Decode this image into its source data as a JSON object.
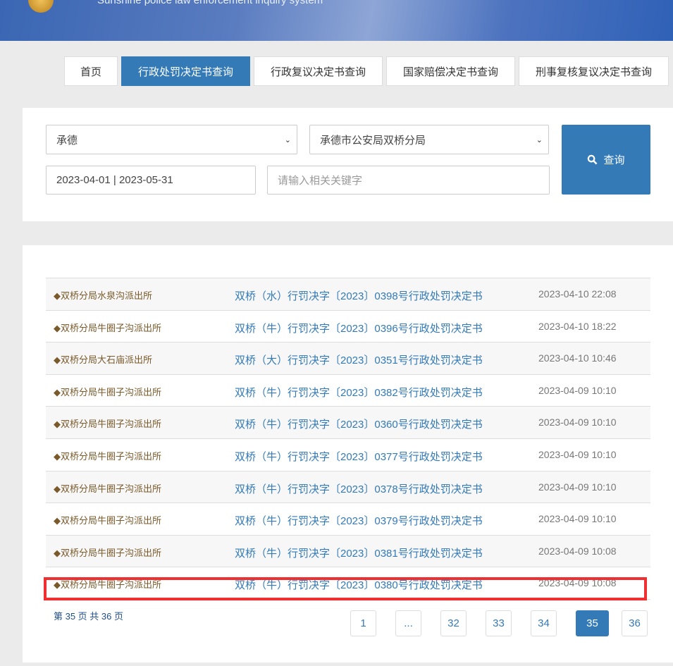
{
  "header": {
    "subtitle": "Sunshine police law enforcement inquiry system"
  },
  "nav": [
    "首页",
    "行政处罚决定书查询",
    "行政复议决定书查询",
    "国家赔偿决定书查询",
    "刑事复核复议决定书查询"
  ],
  "search": {
    "city": "承德",
    "bureau": "承德市公安局双桥分局",
    "date_range": "2023-04-01 | 2023-05-31",
    "keyword_placeholder": "请输入相关关键字",
    "query_label": "查询"
  },
  "results": [
    {
      "branch": "◆双桥分局水泉沟派出所",
      "title": "双桥（水）行罚决字〔2023〕0398号行政处罚决定书",
      "date": "2023-04-10 22:08"
    },
    {
      "branch": "◆双桥分局牛圈子沟派出所",
      "title": "双桥（牛）行罚决字〔2023〕0396号行政处罚决定书",
      "date": "2023-04-10 18:22"
    },
    {
      "branch": "◆双桥分局大石庙派出所",
      "title": "双桥（大）行罚决字〔2023〕0351号行政处罚决定书",
      "date": "2023-04-10 10:46"
    },
    {
      "branch": "◆双桥分局牛圈子沟派出所",
      "title": "双桥（牛）行罚决字〔2023〕0382号行政处罚决定书",
      "date": "2023-04-09 10:10"
    },
    {
      "branch": "◆双桥分局牛圈子沟派出所",
      "title": "双桥（牛）行罚决字〔2023〕0360号行政处罚决定书",
      "date": "2023-04-09 10:10"
    },
    {
      "branch": "◆双桥分局牛圈子沟派出所",
      "title": "双桥（牛）行罚决字〔2023〕0377号行政处罚决定书",
      "date": "2023-04-09 10:10"
    },
    {
      "branch": "◆双桥分局牛圈子沟派出所",
      "title": "双桥（牛）行罚决字〔2023〕0378号行政处罚决定书",
      "date": "2023-04-09 10:10"
    },
    {
      "branch": "◆双桥分局牛圈子沟派出所",
      "title": "双桥（牛）行罚决字〔2023〕0379号行政处罚决定书",
      "date": "2023-04-09 10:10"
    },
    {
      "branch": "◆双桥分局牛圈子沟派出所",
      "title": "双桥（牛）行罚决字〔2023〕0381号行政处罚决定书",
      "date": "2023-04-09 10:08"
    },
    {
      "branch": "◆双桥分局牛圈子沟派出所",
      "title": "双桥（牛）行罚决字〔2023〕0380号行政处罚决定书",
      "date": "2023-04-09 10:08"
    }
  ],
  "pagination": {
    "info": "第 35 页 共 36 页",
    "pages": [
      "1",
      "...",
      "32",
      "33",
      "34",
      "35",
      "36"
    ],
    "current": "35"
  }
}
